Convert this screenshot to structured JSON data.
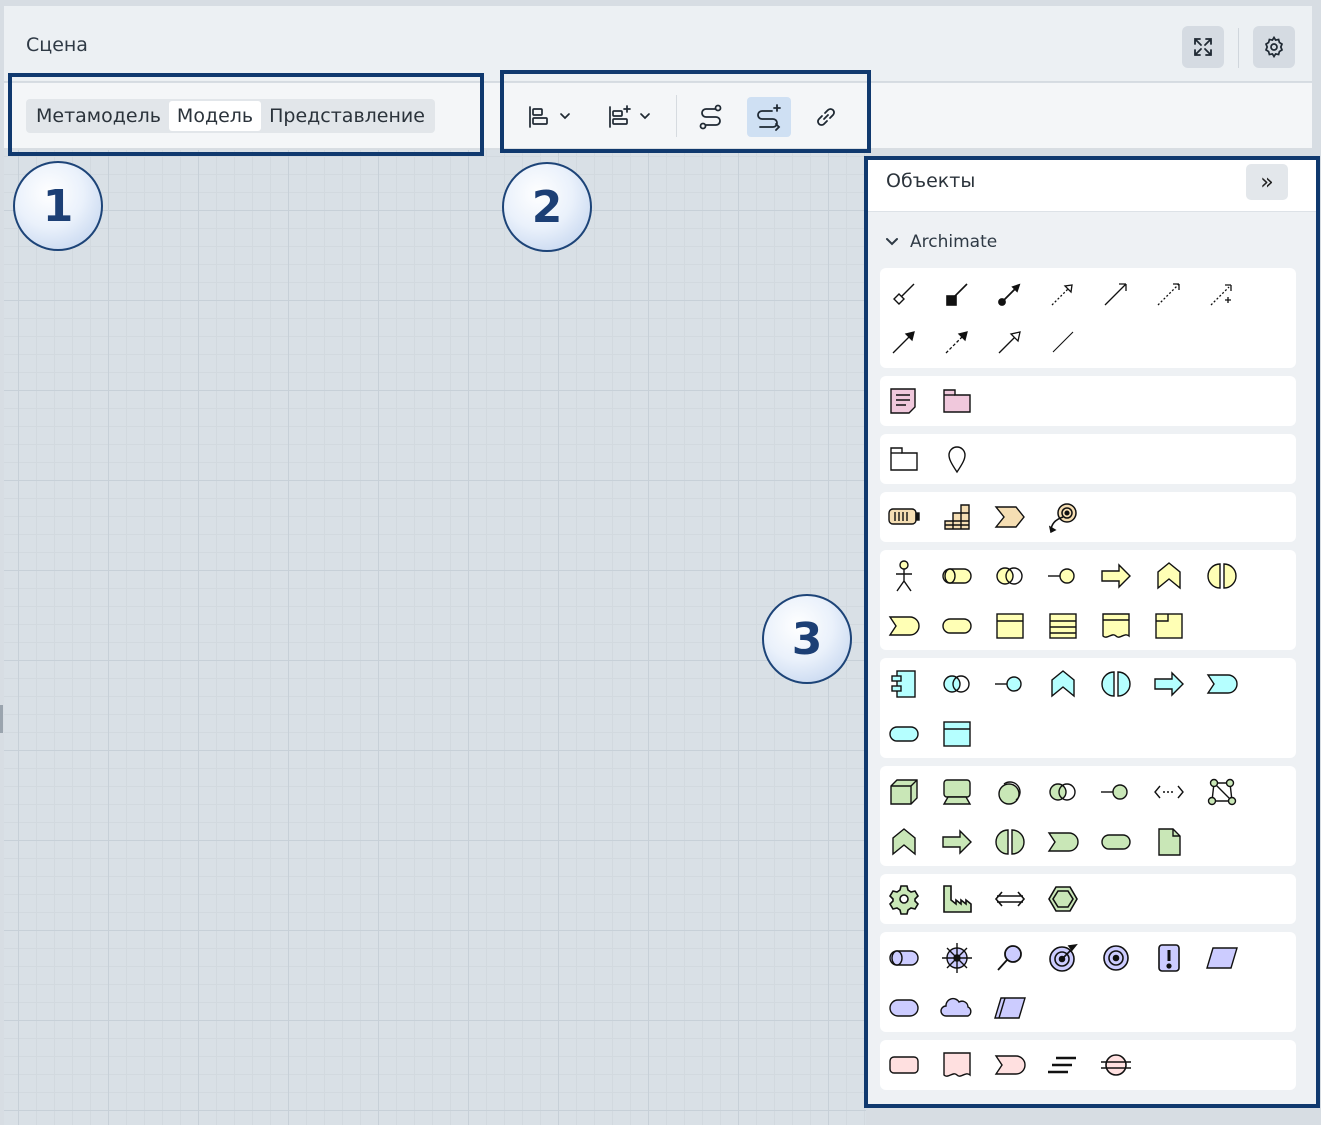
{
  "window": {
    "title": "Сцена"
  },
  "header_buttons": {
    "fullscreen_icon": "expand-icon",
    "settings_icon": "gear-icon"
  },
  "mode_switch": {
    "options": [
      "Метамодель",
      "Модель",
      "Представление"
    ],
    "selected": "Модель"
  },
  "toolbar": {
    "buttons": [
      "align-left-dropdown",
      "align-add-dropdown",
      "route-icon",
      "route-add-icon",
      "link-icon"
    ],
    "active": "route-add-icon"
  },
  "panel": {
    "title": "Объекты",
    "collapse_glyph": "»",
    "section": "Archimate"
  },
  "markers": [
    "1",
    "2",
    "3"
  ],
  "colors": {
    "strategy": "#f5deb3",
    "business": "#ffffb5",
    "application": "#b5ffff",
    "technology": "#c9e7b7",
    "motivation": "#ccccff",
    "implementation": "#ffe0e0",
    "other": "#f0c8dc",
    "annotation": "#10396e"
  }
}
